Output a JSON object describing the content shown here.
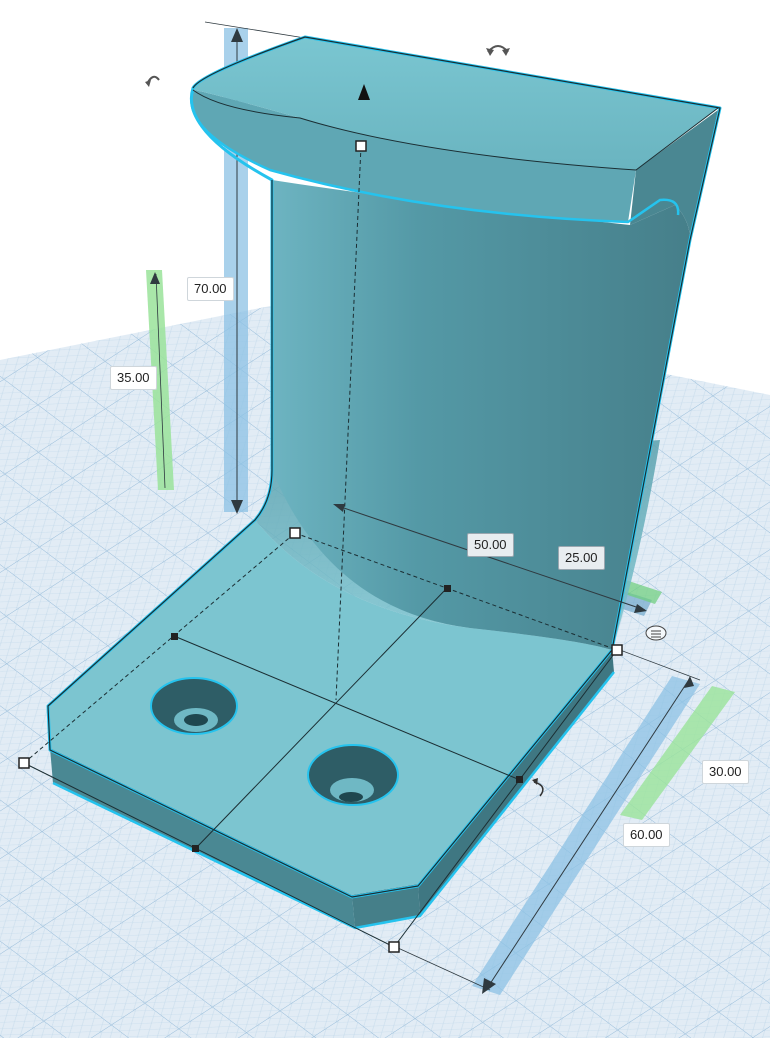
{
  "viewport": {
    "colors": {
      "grid_bg": "#dfeaf4",
      "grid_minor": "#b9d3e7",
      "grid_major": "#8fb6d6",
      "shape_light": "#7ec8d3",
      "shape_mid": "#5aa3b0",
      "shape_dark": "#3f7f8b",
      "selection_outline": "#25c3ee",
      "ruler_blue": "#8cc2e4",
      "ruler_green": "#9ae39a"
    },
    "icons": {
      "rotate_top": "rotate-arrow-icon",
      "rotate_left": "rotate-arrow-icon",
      "rotate_right": "rotate-arrow-icon",
      "lift": "lift-cone-icon",
      "snap": "snap-grid-icon"
    }
  },
  "dimensions": {
    "height_total": "70.00",
    "height_elevation": "35.00",
    "width": "50.00",
    "width_offset": "25.00",
    "length": "60.00",
    "length_offset": "30.00"
  }
}
